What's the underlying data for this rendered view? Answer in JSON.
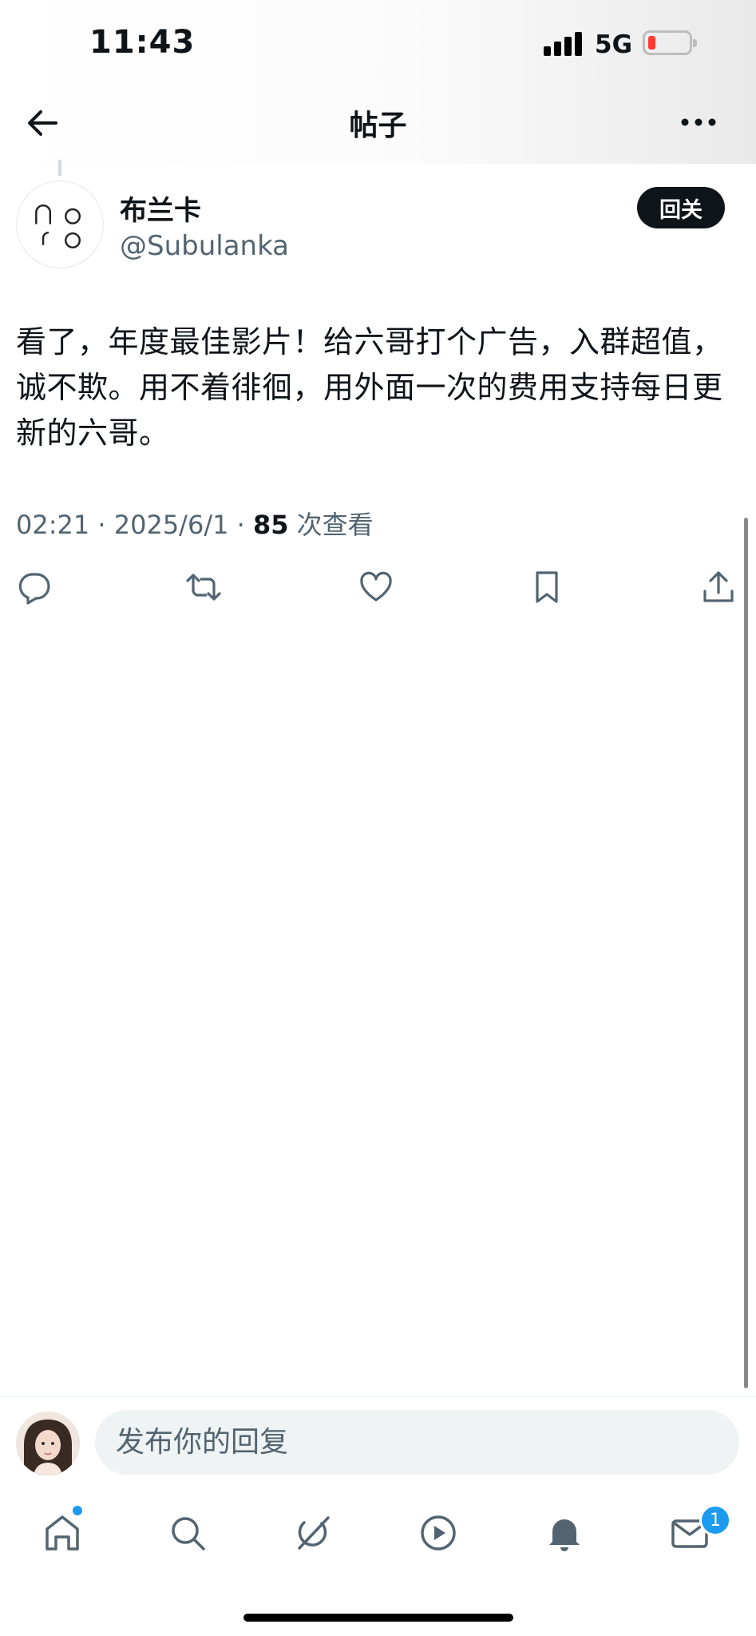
{
  "status": {
    "time": "11:43",
    "network": "5G"
  },
  "header": {
    "title": "帖子"
  },
  "author": {
    "name": "布兰卡",
    "handle": "@Subulanka",
    "follow_label": "回关"
  },
  "post": {
    "text": "看了，年度最佳影片！给六哥打个广告，入群超值，诚不欺。用不着徘徊，用外面一次的费用支持每日更新的六哥。",
    "time": "02:21",
    "date": "2025/6/1",
    "views": "85",
    "views_label": "次查看"
  },
  "actions": [
    "reply-icon",
    "repost-icon",
    "like-icon",
    "bookmark-icon",
    "share-icon"
  ],
  "reply": {
    "placeholder": "发布你的回复"
  },
  "tabs": [
    "home-icon",
    "search-icon",
    "grok-icon",
    "video-icon",
    "notifications-icon",
    "messages-icon"
  ],
  "messages_badge": "1",
  "colors": {
    "accent": "#1d9bf0",
    "text": "#0f1419",
    "secondary": "#536471"
  }
}
